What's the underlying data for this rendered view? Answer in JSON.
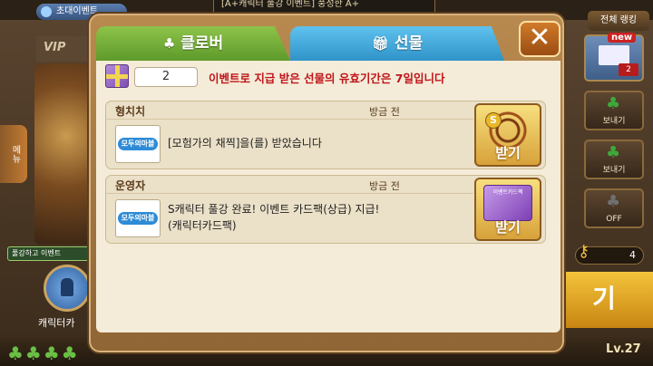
{
  "background": {
    "invite_label": "초대이벤트",
    "event_title": "[A+캐릭터 풀강 이벤트] 풍성한 A+",
    "rank_label": "전체 랭킹",
    "vip_label": "VIP",
    "side_tab_label": "메뉴",
    "tooltip_text": "풀강하고 이벤트",
    "character_label": "캐릭터카",
    "mail": {
      "new_badge": "new",
      "count": "2"
    },
    "send_buttons": [
      "보내기",
      "보내기",
      "OFF"
    ],
    "key_count": "4",
    "start_label": "기",
    "level_label": "Lv.27",
    "clovers": "♣♣♣♣"
  },
  "dialog": {
    "tabs": [
      {
        "label": "클로버",
        "icon": "clover-icon",
        "active": false
      },
      {
        "label": "선물",
        "icon": "gift-icon",
        "active": true
      }
    ],
    "close_icon": "close-icon",
    "gift_count": "2",
    "notice": "이벤트로 지급 받은 선물의 유효기간은 7일입니다",
    "gifts": [
      {
        "sender": "형치치",
        "time": "방금 전",
        "logo_text": "모두의마블",
        "message": "[모험가의 채찍]을(를) 받았습니다",
        "item_icon": "whip-icon",
        "badge": "S",
        "button_label": "받기"
      },
      {
        "sender": "운영자",
        "time": "방금 전",
        "logo_text": "모두의마블",
        "message": "S캐릭터 풀강 완료! 이벤트 카드팩(상급) 지급!\n(캐릭터카드팩)",
        "item_icon": "card-pack-icon",
        "card_text": "이벤트카드팩",
        "button_label": "받기"
      }
    ]
  }
}
